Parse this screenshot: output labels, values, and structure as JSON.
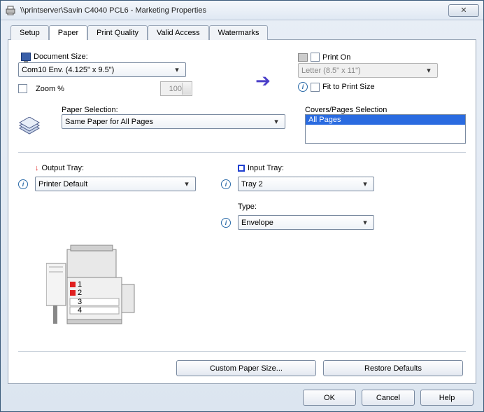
{
  "title": "\\\\printserver\\Savin C4040 PCL6 - Marketing Properties",
  "tabs": [
    "Setup",
    "Paper",
    "Print Quality",
    "Valid Access",
    "Watermarks"
  ],
  "active_tab": 1,
  "doc_size": {
    "label": "Document Size:",
    "value": "Com10 Env. (4.125\" x 9.5\")"
  },
  "zoom": {
    "label": "Zoom %",
    "value": "100"
  },
  "print_on": {
    "label": "Print On",
    "value": "Letter (8.5\" x 11\")"
  },
  "fit": {
    "label": "Fit to Print Size"
  },
  "paper_sel": {
    "label": "Paper Selection:",
    "value": "Same Paper for All Pages"
  },
  "covers": {
    "label": "Covers/Pages Selection",
    "selected": "All Pages"
  },
  "output_tray": {
    "label": "Output Tray:",
    "value": "Printer Default"
  },
  "input_tray": {
    "label": "Input Tray:",
    "value": "Tray 2"
  },
  "type": {
    "label": "Type:",
    "value": "Envelope"
  },
  "buttons": {
    "custom_paper": "Custom Paper Size...",
    "restore": "Restore Defaults",
    "ok": "OK",
    "cancel": "Cancel",
    "help": "Help"
  }
}
